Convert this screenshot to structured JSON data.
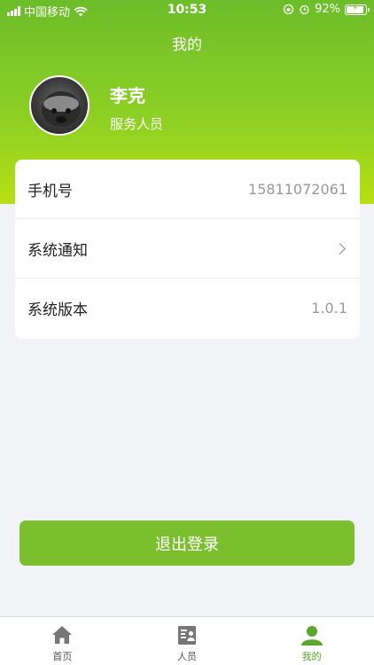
{
  "status": {
    "carrier": "中国移动",
    "time": "10:53",
    "battery": "92%",
    "battery_level": 0.92
  },
  "header": {
    "title": "我的"
  },
  "profile": {
    "name": "李克",
    "role": "服务人员"
  },
  "info_rows": [
    {
      "label": "手机号",
      "value": "15811072061"
    },
    {
      "label": "系统通知",
      "value": ""
    },
    {
      "label": "系统版本",
      "value": "1.0.1"
    }
  ],
  "actions": {
    "logout_label": "退出登录"
  },
  "tabs": [
    {
      "label": "首页",
      "icon": "home-icon"
    },
    {
      "label": "人员",
      "icon": "contacts-icon"
    },
    {
      "label": "我的",
      "icon": "user-icon"
    }
  ],
  "colors": {
    "accent": "#7cbf2e",
    "tab_active": "#5aa72b"
  }
}
